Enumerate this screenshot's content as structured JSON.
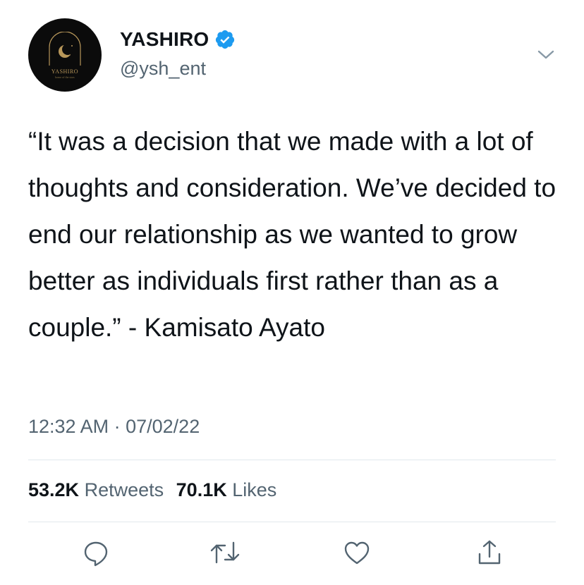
{
  "account": {
    "display_name": "YASHIRO",
    "handle": "@ysh_ent",
    "verified": true,
    "avatar_text": "YASHIRO",
    "avatar_tagline": "home of the stars"
  },
  "tweet": {
    "text": "“It was a decision that we made with a lot of thoughts and consideration. We’ve decided to end our relationship as we wanted to grow better as individuals first rather than as a couple.” - Kamisato Ayato",
    "time": "12:32 AM",
    "separator": "·",
    "date": "07/02/22"
  },
  "stats": {
    "retweets_count": "53.2K",
    "retweets_label": "Retweets",
    "likes_count": "70.1K",
    "likes_label": "Likes"
  },
  "icons": {
    "reply": "reply-icon",
    "retweet": "retweet-icon",
    "like": "heart-icon",
    "share": "share-icon",
    "more": "chevron-down-icon",
    "verified": "verified-badge-icon"
  },
  "colors": {
    "text": "#0f1419",
    "secondary": "#536471",
    "verified": "#1d9bf0",
    "avatar_bg": "#0b0b0b",
    "avatar_gold": "#b8975a"
  }
}
